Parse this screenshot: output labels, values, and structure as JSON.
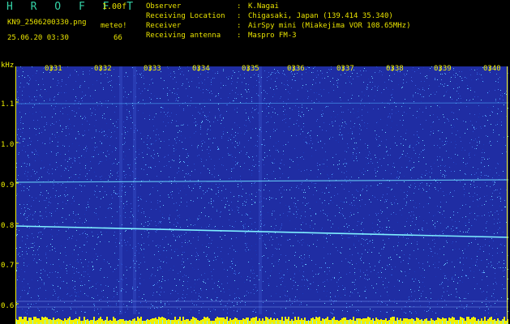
{
  "header": {
    "app_title": "H R O F F T",
    "version": "1.00f",
    "file_name": "KN9_2506200330.png",
    "meteor_label": "meteo!",
    "date_time": "25.06.20 03:30",
    "count": "66",
    "info": [
      {
        "key": "Observer",
        "value": "K.Nagai"
      },
      {
        "key": "Receiving Location",
        "value": "Chigasaki, Japan (139.414 35.340)"
      },
      {
        "key": "Receiver",
        "value": "AirSpy mini (Miakejima VOR 108.65MHz)"
      },
      {
        "key": "Receiving antenna",
        "value": "Maspro FM-3"
      }
    ]
  },
  "spectrogram": {
    "y_unit": "kHz",
    "y_ticks": [
      "1.1",
      "1.0",
      "0.9",
      "0.8",
      "0.7",
      "0.6"
    ],
    "time_ticks": [
      "0331",
      "0332",
      "0333",
      "0334",
      "0335",
      "0336",
      "0337",
      "0338",
      "0339",
      "0340"
    ],
    "background_color": "#1f2da3",
    "trace_color": "#7ff0ff",
    "axis_color": "#f0f000"
  }
}
